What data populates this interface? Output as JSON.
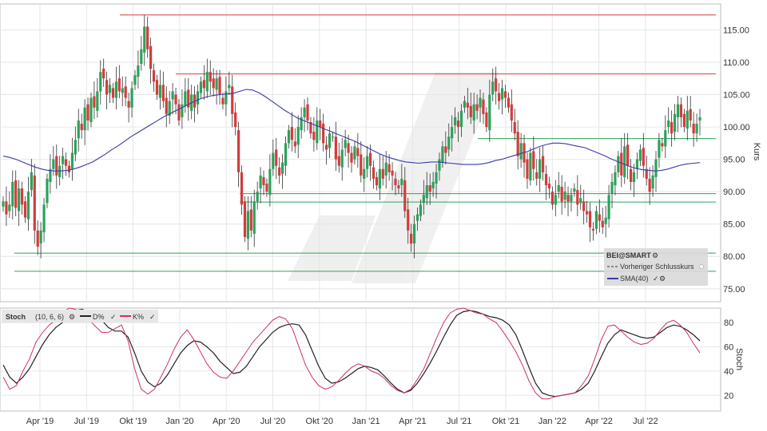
{
  "chart_data": [
    {
      "type": "candlestick",
      "symbol": "BEI@SMART",
      "ylabel": "Kurs",
      "ylim": [
        73,
        119
      ],
      "y_ticks": [
        75.0,
        80.0,
        85.0,
        90.0,
        95.0,
        100.0,
        105.0,
        110.0,
        115.0
      ],
      "y_tick_labels": [
        "75.00",
        "80.00",
        "85.00",
        "90.00",
        "95.00",
        "100.00",
        "105.00",
        "110.00",
        "115.00"
      ],
      "x_tick_labels": [
        "Apr '19",
        "Jul '19",
        "Okt '19",
        "Jan '20",
        "Apr '20",
        "Jul '20",
        "Okt '20",
        "Jan '21",
        "Apr '21",
        "Jul '21",
        "Okt '21",
        "Jan '22",
        "Apr '22",
        "Jul '22"
      ],
      "legend": {
        "position": "bottom-right",
        "title": "BEI@SMART",
        "items": [
          {
            "label": "Vorheriger Schlusskurs",
            "style": "dashed",
            "color": "#555555"
          },
          {
            "label": "SMA(40)",
            "style": "solid",
            "color": "#3a3aa8"
          }
        ]
      },
      "horizontal_lines": [
        {
          "value": 117.3,
          "color": "#d43b3b"
        },
        {
          "value": 108.2,
          "color": "#d43b3b"
        },
        {
          "value": 98.2,
          "color": "#2aa35a"
        },
        {
          "value": 89.7,
          "color": "#2aa35a"
        },
        {
          "value": 88.4,
          "color": "#2aa35a"
        },
        {
          "value": 80.5,
          "color": "#2aa35a"
        },
        {
          "value": 77.7,
          "color": "#2aa35a"
        }
      ],
      "candle_close": [
        88.5,
        86.5,
        88.0,
        91.5,
        87.5,
        90.5,
        88.0,
        86.0,
        90.0,
        93.0,
        84.0,
        81.5,
        84.0,
        88.0,
        92.0,
        93.5,
        95.0,
        92.5,
        94.0,
        95.5,
        94.0,
        93.0,
        96.0,
        98.0,
        101.0,
        99.5,
        103.0,
        101.0,
        104.5,
        103.0,
        105.5,
        108.5,
        107.5,
        105.0,
        106.5,
        104.5,
        107.0,
        105.5,
        106.0,
        104.5,
        103.0,
        106.0,
        108.0,
        109.5,
        112.0,
        115.5,
        112.0,
        109.0,
        107.0,
        105.0,
        106.5,
        104.0,
        102.0,
        104.0,
        105.5,
        103.5,
        101.0,
        103.5,
        105.5,
        103.0,
        105.0,
        103.0,
        105.5,
        107.0,
        106.0,
        108.5,
        107.0,
        106.0,
        107.5,
        105.0,
        103.5,
        105.5,
        106.5,
        102.0,
        100.0,
        93.0,
        88.0,
        83.0,
        87.0,
        84.0,
        88.5,
        90.0,
        92.5,
        91.0,
        90.0,
        93.5,
        96.0,
        94.0,
        92.5,
        94.5,
        97.5,
        99.5,
        98.0,
        97.0,
        100.0,
        101.5,
        103.0,
        101.0,
        99.0,
        98.0,
        101.0,
        100.0,
        97.5,
        96.5,
        99.0,
        98.5,
        95.0,
        94.0,
        96.5,
        98.0,
        96.0,
        94.5,
        97.0,
        95.5,
        92.5,
        93.5,
        95.5,
        94.0,
        92.0,
        91.0,
        93.5,
        92.0,
        94.5,
        93.0,
        92.5,
        91.0,
        90.5,
        92.0,
        87.0,
        84.0,
        82.0,
        85.0,
        86.5,
        88.0,
        89.5,
        91.0,
        90.0,
        91.5,
        93.0,
        95.0,
        97.0,
        96.0,
        98.5,
        100.0,
        101.5,
        100.0,
        102.5,
        104.0,
        103.0,
        101.5,
        103.5,
        102.5,
        104.5,
        102.0,
        100.0,
        105.0,
        107.0,
        105.5,
        104.0,
        106.0,
        104.5,
        103.0,
        101.0,
        99.0,
        95.5,
        97.5,
        94.5,
        92.0,
        96.0,
        93.5,
        92.0,
        95.0,
        93.0,
        91.0,
        90.5,
        88.0,
        89.5,
        91.0,
        88.5,
        90.0,
        88.5,
        89.5,
        90.5,
        88.0,
        89.0,
        87.0,
        86.5,
        84.5,
        84.0,
        87.0,
        85.5,
        84.5,
        86.0,
        89.5,
        91.5,
        93.0,
        95.5,
        92.5,
        97.0,
        94.0,
        91.5,
        93.0,
        95.0,
        96.5,
        94.0,
        92.0,
        90.0,
        92.5,
        95.0,
        98.0,
        97.0,
        99.5,
        101.0,
        99.0,
        102.0,
        103.5,
        101.5,
        100.0,
        102.5,
        101.0,
        99.0,
        100.5,
        101.5
      ],
      "sma40": [
        95.5,
        95.3,
        95.0,
        94.6,
        94.2,
        93.8,
        93.5,
        93.3,
        93.2,
        93.2,
        93.3,
        93.5,
        93.8,
        94.2,
        94.6,
        95.2,
        95.8,
        96.5,
        97.1,
        97.8,
        98.5,
        99.1,
        99.7,
        100.3,
        100.9,
        101.5,
        102.0,
        102.5,
        103.0,
        103.5,
        104.0,
        104.4,
        104.7,
        104.9,
        105.0,
        105.1,
        105.2,
        105.5,
        105.8,
        105.7,
        105.3,
        104.7,
        104.0,
        103.3,
        102.6,
        102.0,
        101.4,
        101.0,
        100.6,
        100.2,
        99.8,
        99.4,
        99.0,
        98.6,
        98.2,
        97.8,
        97.3,
        96.8,
        96.3,
        95.8,
        95.4,
        95.1,
        94.8,
        94.6,
        94.5,
        94.4,
        94.5,
        94.6,
        94.6,
        94.5,
        94.4,
        94.3,
        94.2,
        94.2,
        94.2,
        94.3,
        94.5,
        94.8,
        95.0,
        95.3,
        95.6,
        95.9,
        96.2,
        96.6,
        97.0,
        97.3,
        97.5,
        97.5,
        97.4,
        97.2,
        97.0,
        96.8,
        96.4,
        96.0,
        95.6,
        95.1,
        94.7,
        94.3,
        93.9,
        93.6,
        93.4,
        93.3,
        93.2,
        93.3,
        93.5,
        93.8,
        94.1,
        94.3,
        94.4,
        94.5
      ],
      "stoch": {
        "params_label": "(10, 6, 6)",
        "ylabel": "Stoch",
        "ylim": [
          7,
          92
        ],
        "y_ticks": [
          20,
          40,
          60,
          80
        ],
        "series": [
          {
            "name": "D%",
            "color": "#222222",
            "values": [
              45,
              35,
              30,
              35,
              42,
              52,
              62,
              70,
              76,
              80,
              86,
              90,
              91,
              89,
              86,
              82,
              76,
              73,
              73,
              68,
              55,
              40,
              31,
              27,
              30,
              37,
              46,
              55,
              61,
              65,
              64,
              60,
              55,
              48,
              43,
              38,
              39,
              44,
              52,
              60,
              66,
              72,
              76,
              78,
              79,
              78,
              70,
              57,
              44,
              34,
              30,
              31,
              34,
              38,
              42,
              44,
              43,
              41,
              36,
              30,
              25,
              22,
              24,
              30,
              38,
              47,
              57,
              68,
              78,
              86,
              89,
              90,
              89,
              87,
              85,
              84,
              82,
              78,
              70,
              57,
              43,
              30,
              22,
              20,
              19,
              20,
              21,
              22,
              25,
              30,
              40,
              52,
              63,
              70,
              74,
              72,
              70,
              68,
              67,
              68,
              72,
              76,
              78,
              77,
              74,
              70,
              65
            ]
          },
          {
            "name": "K%",
            "color": "#d03060",
            "values": [
              35,
              25,
              28,
              40,
              50,
              64,
              72,
              78,
              82,
              88,
              92,
              91,
              88,
              83,
              77,
              72,
              72,
              75,
              78,
              65,
              42,
              25,
              21,
              25,
              35,
              46,
              58,
              68,
              74,
              66,
              56,
              46,
              39,
              35,
              34,
              40,
              48,
              56,
              64,
              70,
              76,
              82,
              85,
              83,
              75,
              60,
              45,
              35,
              28,
              25,
              27,
              32,
              38,
              43,
              46,
              44,
              40,
              38,
              34,
              28,
              24,
              22,
              25,
              33,
              42,
              55,
              68,
              80,
              88,
              91,
              92,
              90,
              88,
              87,
              83,
              80,
              73,
              65,
              56,
              45,
              32,
              22,
              17,
              17,
              19,
              20,
              21,
              22,
              28,
              36,
              50,
              66,
              77,
              78,
              73,
              68,
              64,
              62,
              63,
              67,
              74,
              80,
              82,
              78,
              72,
              63,
              55
            ]
          }
        ]
      }
    }
  ]
}
